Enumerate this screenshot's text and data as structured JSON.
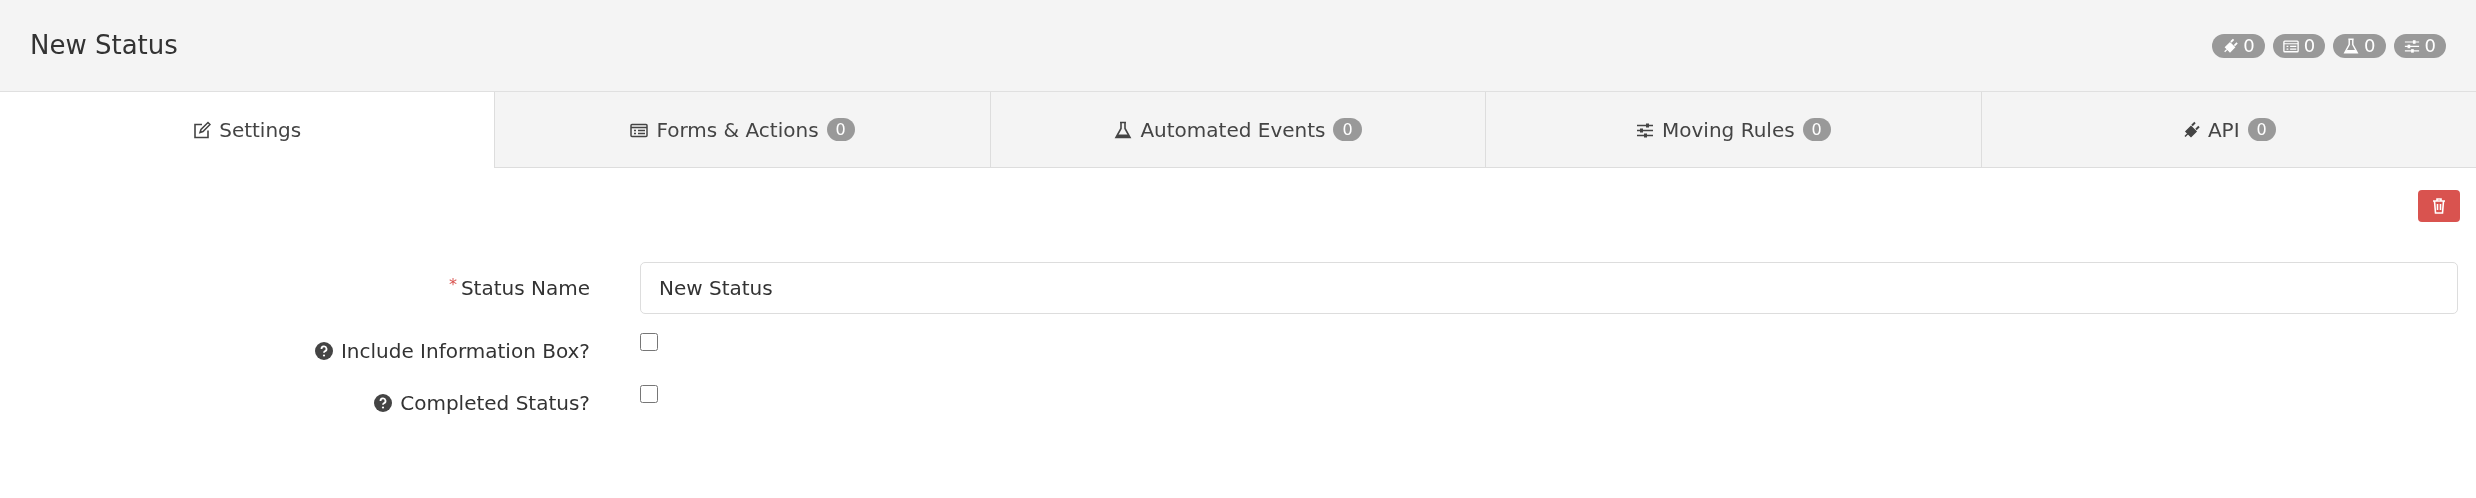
{
  "header": {
    "title": "New Status",
    "counters": [
      {
        "kind": "plug",
        "count": "0"
      },
      {
        "kind": "list",
        "count": "0"
      },
      {
        "kind": "flask",
        "count": "0"
      },
      {
        "kind": "sliders",
        "count": "0"
      }
    ]
  },
  "tabs": [
    {
      "label": "Settings",
      "kind": "edit",
      "selected": true
    },
    {
      "label": "Forms & Actions",
      "kind": "list",
      "count": "0",
      "selected": false
    },
    {
      "label": "Automated Events",
      "kind": "flask",
      "count": "0",
      "selected": false
    },
    {
      "label": "Moving Rules",
      "kind": "sliders",
      "count": "0",
      "selected": false
    },
    {
      "label": "API",
      "kind": "plug",
      "count": "0",
      "selected": false
    }
  ],
  "fields": [
    {
      "kind": "text",
      "required_mark": "*",
      "label": "Status Name",
      "help": false,
      "value": "New Status"
    },
    {
      "kind": "checkbox",
      "label": "Include Information Box?",
      "help": true,
      "checked": false
    },
    {
      "kind": "checkbox",
      "label": "Completed Status?",
      "help": true,
      "checked": false
    }
  ]
}
